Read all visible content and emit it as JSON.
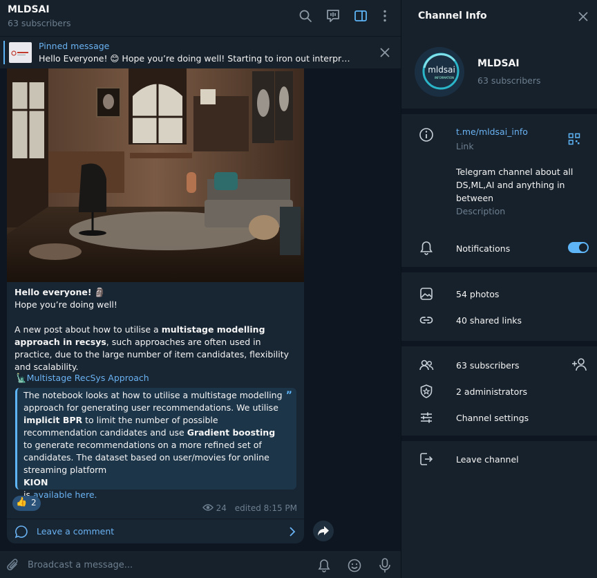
{
  "header": {
    "title": "MLDSAI",
    "subtitle": "63 subscribers"
  },
  "pinned": {
    "label": "Pinned message",
    "text": "Hello Everyone! 😊 Hope you’re doing well!      Starting to iron out interpr…"
  },
  "post": {
    "greeting": "Hello everyone!",
    "greeting_emoji": "🗿",
    "line2": "Hope you’re doing well!",
    "para_1": "A new post about how to utilise a ",
    "para_bold": "multistage modelling approach in recsys",
    "para_2": ", such approaches are often used in practice, due to the large number of item candidates, flexibility and scalability.",
    "link_emoji": "🗽",
    "link_title": "Multistage RecSys Approach",
    "quote_1": "The notebook looks at how to utilise a multistage modelling approach for generating user recommendations. We utilise ",
    "quote_bold_1": "implicit BPR",
    "quote_2": " to limit the number of possible recommendation candidates and use ",
    "quote_bold_2": "Gradient boosting",
    "quote_3": " to generate recommendations on a more refined set of candidates. The dataset based on user/movies for online streaming platform ",
    "quote_bold_3": "KION",
    "quote_4": "is ",
    "quote_link": "available here.",
    "reaction_emoji": "👍",
    "reaction_count": "2",
    "views": "24",
    "edited": "edited 8:15 PM",
    "comment_label": "Leave a comment"
  },
  "composer": {
    "placeholder": "Broadcast a message..."
  },
  "info": {
    "title": "Channel Info",
    "name": "MLDSAI",
    "subscribers": "63 subscribers",
    "avatar_text": "mldsai",
    "avatar_subtext": "INFORMATION",
    "link": "t.me/mldsai_info",
    "link_caption": "Link",
    "description": "Telegram channel about all DS,ML,AI and anything in between",
    "description_caption": "Description",
    "notifications": "Notifications",
    "notifications_on": true,
    "photos": "54 photos",
    "shared_links": "40 shared links",
    "subscribers_row": "63 subscribers",
    "administrators": "2 administrators",
    "settings": "Channel settings",
    "leave": "Leave channel"
  },
  "colors": {
    "accent": "#5eb5f7",
    "link": "#6ab3f3",
    "background": "#0e1621",
    "panel": "#17212b",
    "bubble": "#182533"
  }
}
